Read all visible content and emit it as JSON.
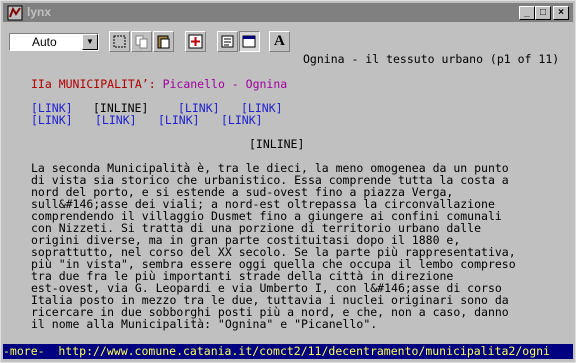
{
  "window": {
    "title": "lynx"
  },
  "toolbar": {
    "font_select": "Auto",
    "tools": [
      "select-tool-icon",
      "copy-tool-icon",
      "paste-tool-icon",
      "fullscreen-icon",
      "properties-icon",
      "window-icon",
      "font-icon"
    ],
    "font_letter": "A"
  },
  "page": {
    "header": "Ognina - il tessuto urbano (p1 of 11)",
    "heading_part1": "IIa MUNICIPALITA’: ",
    "heading_part2": "Picanello - Ognina",
    "links_row1": {
      "l1": "[LINK]",
      "inline": "[INLINE]",
      "l2": "[LINK]",
      "l3": "[LINK]"
    },
    "links_row2": {
      "l1": "[LINK]",
      "l2": "[LINK]",
      "l3": "[LINK]",
      "l4": "[LINK]"
    },
    "inline_center": "[INLINE]",
    "paragraph": [
      "La seconda Municipalità è, tra le dieci, la meno omogenea da un punto",
      "di vista sia storico che urbanistico. Essa comprende tutta la costa a",
      "nord del porto, e si estende a sud-ovest fino a piazza Verga,",
      "sull&#146;asse dei viali; a nord-est oltrepassa la circonvallazione",
      "comprendendo il villaggio Dusmet fino a giungere ai confini comunali",
      "con Nizzeti. Si tratta di una porzione di territorio urbano dalle",
      "origini diverse, ma in gran parte costituitasi dopo il 1880 e,",
      "soprattutto, nel corso del XX secolo. Se la parte più rappresentativa,",
      "più \"in vista\", sembra essere oggi quella che occupa il lembo compreso",
      "tra due fra le più importanti strade della città in direzione",
      "est-ovest, via G. Leopardi e via Umberto I, con l&#146;asse di corso",
      "Italia posto in mezzo tra le due, tuttavia i nuclei originari sono da",
      "ricercare in due sobborghi posti più a nord, e che, non a caso, danno",
      "il nome alla Municipalità: \"Ognina\" e \"Picanello\"."
    ]
  },
  "status": "-more-  http://www.comune.catania.it/comct2/11/decentramento/municipalita2/ogni",
  "colors": {
    "title_bar": "#808080",
    "chrome": "#c0c0c0",
    "status_bg": "#000080",
    "status_fg": "#ffff55",
    "heading_red": "#b00000",
    "heading_magenta": "#a000a0",
    "link_blue": "#2020d0"
  }
}
